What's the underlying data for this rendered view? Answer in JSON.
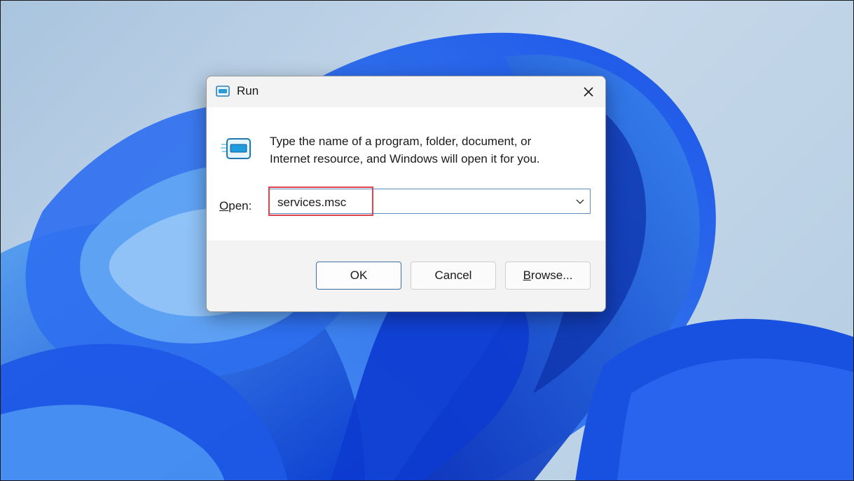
{
  "dialog": {
    "title": "Run",
    "description_line1": "Type the name of a program, folder, document, or",
    "description_line2": "Internet resource, and Windows will open it for you.",
    "open_label_mnemonic": "O",
    "open_label_rest": "pen:",
    "open_value": "services.msc",
    "ok_label": "OK",
    "cancel_label": "Cancel",
    "browse_mnemonic": "B",
    "browse_rest": "rowse..."
  },
  "icons": {
    "title": "run-icon",
    "program": "run-program-icon",
    "close": "close-icon",
    "dropdown": "chevron-down-icon"
  },
  "colors": {
    "highlight": "#e0434b",
    "accent": "#3b6ea5",
    "wallpaper_blue": "#1f5fe6"
  }
}
